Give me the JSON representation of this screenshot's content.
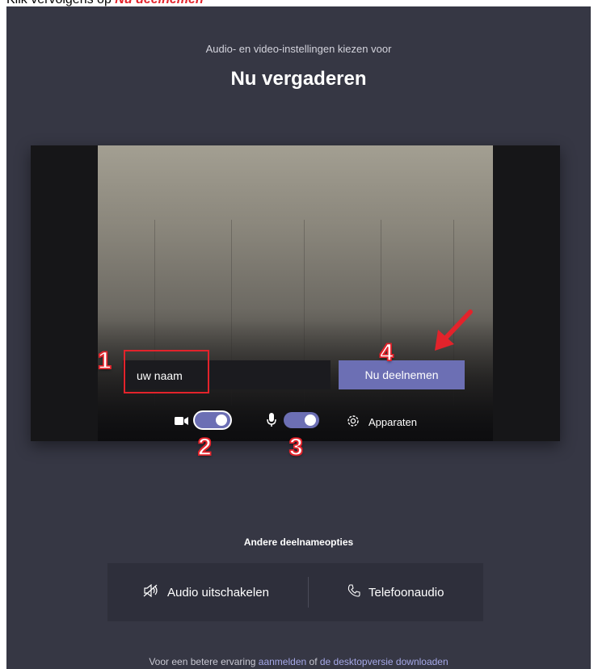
{
  "caption": {
    "prefix": "Klik vervolgens op",
    "highlight": "Nu deelnemen"
  },
  "header": {
    "subtitle": "Audio- en video-instellingen kiezen voor",
    "title": "Nu vergaderen"
  },
  "prejoin": {
    "name_value": "uw naam",
    "join_label": "Nu deelnemen",
    "camera_on": true,
    "mic_on": true,
    "devices_label": "Apparaten"
  },
  "annotations": [
    "1",
    "2",
    "3",
    "4"
  ],
  "other_options": {
    "title": "Andere deelnameopties",
    "audio_off_label": "Audio uitschakelen",
    "phone_audio_label": "Telefoonaudio"
  },
  "footer": {
    "text_prefix": "Voor een betere ervaring",
    "link_signin": "aanmelden",
    "text_middle": "of",
    "link_download": "de desktopversie downloaden"
  },
  "colors": {
    "background": "#363744",
    "accent": "#6c6fb4",
    "annotation_red": "#e3232b"
  },
  "icons": [
    "video-camera-icon",
    "microphone-icon",
    "gear-icon",
    "speaker-off-icon",
    "phone-icon",
    "red-arrow-icon"
  ]
}
